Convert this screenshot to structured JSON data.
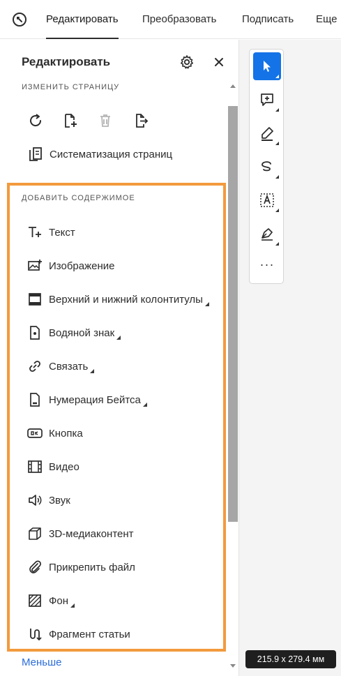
{
  "topbar": {
    "tabs": [
      {
        "label": "Редактировать",
        "active": true
      },
      {
        "label": "Преобразовать",
        "active": false
      },
      {
        "label": "Подписать",
        "active": false
      },
      {
        "label": "Еще",
        "active": false
      }
    ]
  },
  "panel": {
    "title": "Редактировать",
    "change_page_label": "ИЗМЕНИТЬ СТРАНИЦУ",
    "page_tools": [
      "rotate-icon",
      "insert-page-icon",
      "delete-page-icon",
      "extract-page-icon"
    ],
    "organize_label": "Систематизация страниц",
    "add_content_label": "ДОБАВИТЬ СОДЕРЖИМОЕ",
    "items": [
      {
        "label": "Текст",
        "icon": "add-text-icon",
        "submenu": false
      },
      {
        "label": "Изображение",
        "icon": "add-image-icon",
        "submenu": false
      },
      {
        "label": "Верхний и нижний колонтитулы",
        "icon": "header-footer-icon",
        "submenu": true
      },
      {
        "label": "Водяной знак",
        "icon": "watermark-icon",
        "submenu": true
      },
      {
        "label": "Связать",
        "icon": "link-icon",
        "submenu": true
      },
      {
        "label": "Нумерация Бейтса",
        "icon": "bates-numbering-icon",
        "submenu": true
      },
      {
        "label": "Кнопка",
        "icon": "button-icon",
        "submenu": false
      },
      {
        "label": "Видео",
        "icon": "video-icon",
        "submenu": false
      },
      {
        "label": "Звук",
        "icon": "sound-icon",
        "submenu": false
      },
      {
        "label": "3D-медиаконтент",
        "icon": "3d-media-icon",
        "submenu": false
      },
      {
        "label": "Прикрепить файл",
        "icon": "attach-file-icon",
        "submenu": false
      },
      {
        "label": "Фон",
        "icon": "background-icon",
        "submenu": true
      },
      {
        "label": "Фрагмент статьи",
        "icon": "article-icon",
        "submenu": false
      }
    ],
    "less_link": "Меньше"
  },
  "tools": [
    "select-tool-icon",
    "add-comment-icon",
    "highlight-icon",
    "freehand-draw-icon",
    "text-box-icon",
    "sign-icon",
    "more-icon"
  ],
  "more_label": "···",
  "page_size": "215.9 x 279.4 мм",
  "colors": {
    "accent": "#1473e6",
    "highlight_border": "#f39a3d",
    "link": "#2b6cd9",
    "badge_bg": "#1f1f1f"
  }
}
